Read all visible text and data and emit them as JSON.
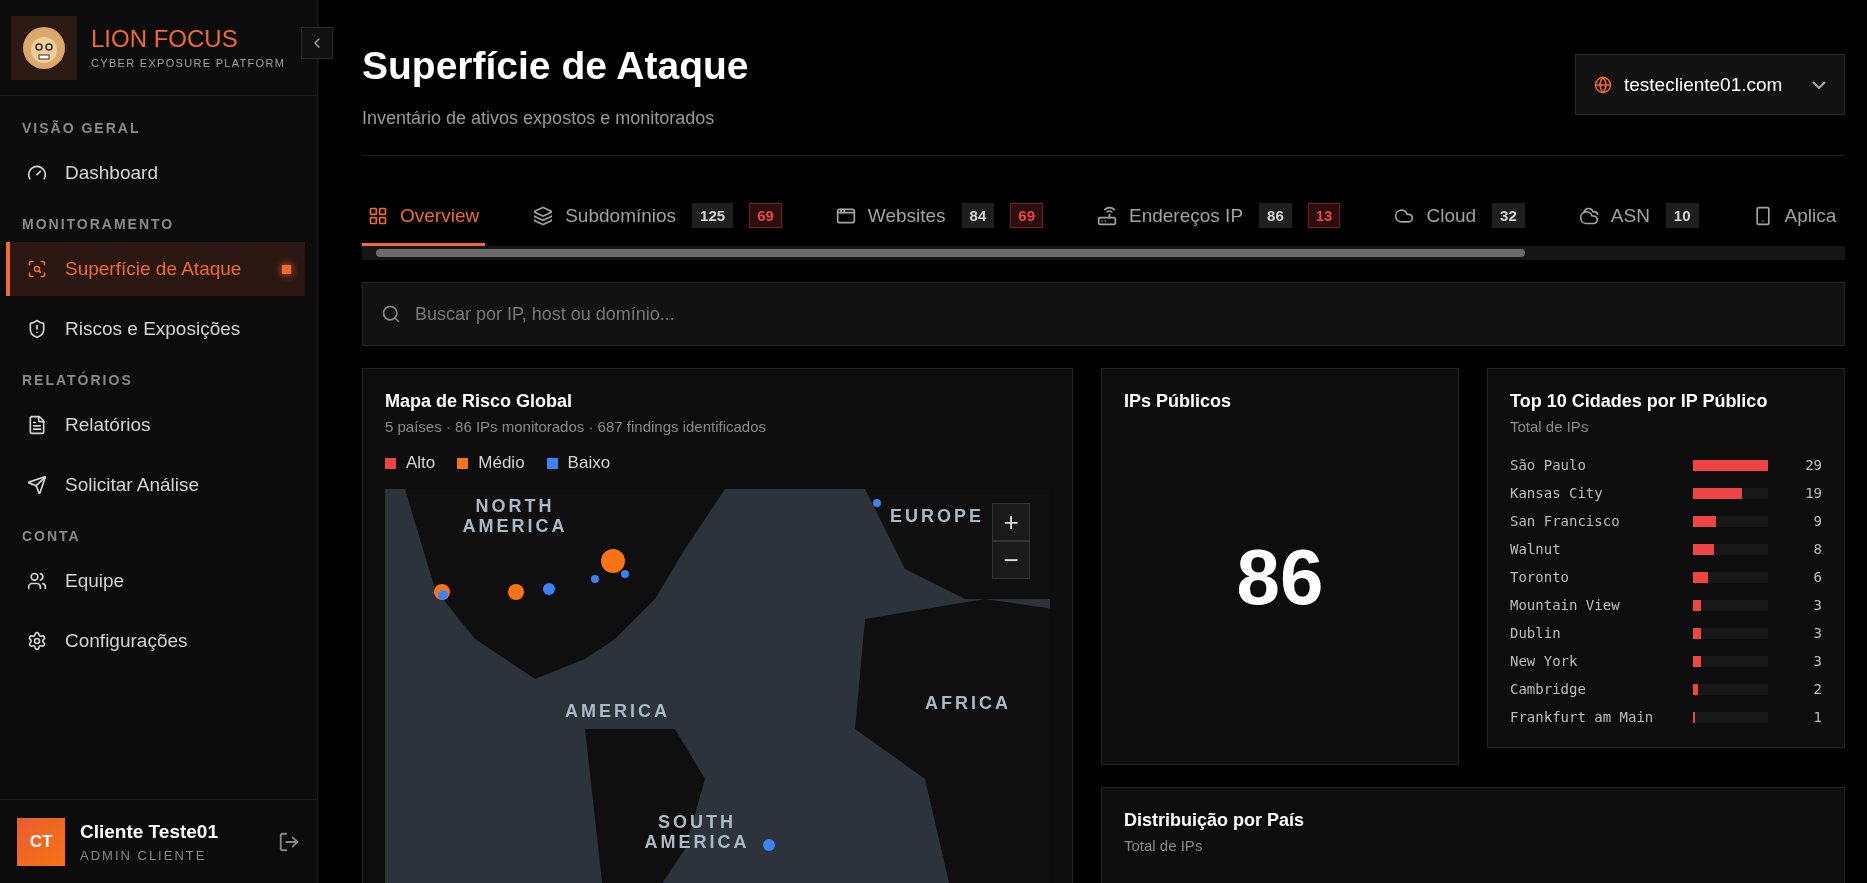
{
  "sidebar": {
    "brand": {
      "name": "LION FOCUS",
      "tagline": "CYBER EXPOSURE PLATFORM"
    },
    "sections": [
      {
        "title": "VISÃO GERAL",
        "items": [
          {
            "label": "Dashboard",
            "selected": false,
            "badge": false
          }
        ]
      },
      {
        "title": "MONITORAMENTO",
        "items": [
          {
            "label": "Superfície de Ataque",
            "selected": true,
            "badge": true
          },
          {
            "label": "Riscos e Exposições",
            "selected": false,
            "badge": false
          }
        ]
      },
      {
        "title": "RELATÓRIOS",
        "items": [
          {
            "label": "Relatórios",
            "selected": false,
            "badge": false
          },
          {
            "label": "Solicitar Análise",
            "selected": false,
            "badge": false
          }
        ]
      },
      {
        "title": "CONTA",
        "items": [
          {
            "label": "Equipe",
            "selected": false,
            "badge": false
          },
          {
            "label": "Configurações",
            "selected": false,
            "badge": false
          }
        ]
      }
    ],
    "user": {
      "initials": "CT",
      "name": "Cliente Teste01",
      "role": "ADMIN CLIENTE"
    }
  },
  "header": {
    "title": "Superfície de Ataque",
    "subtitle": "Inventário de ativos expostos e monitorados",
    "domain": "testecliente01.com"
  },
  "tabs": [
    {
      "label": "Overview",
      "selected": true
    },
    {
      "label": "Subdomínios",
      "selected": false,
      "counts": [
        {
          "text": "125",
          "kind": "total"
        },
        {
          "text": "69",
          "kind": "alert"
        }
      ]
    },
    {
      "label": "Websites",
      "selected": false,
      "counts": [
        {
          "text": "84",
          "kind": "total"
        },
        {
          "text": "69",
          "kind": "alert"
        }
      ]
    },
    {
      "label": "Endereços IP",
      "selected": false,
      "counts": [
        {
          "text": "86",
          "kind": "total"
        },
        {
          "text": "13",
          "kind": "alert"
        }
      ]
    },
    {
      "label": "Cloud",
      "selected": false,
      "counts": [
        {
          "text": "32",
          "kind": "total"
        }
      ]
    },
    {
      "label": "ASN",
      "selected": false,
      "counts": [
        {
          "text": "10",
          "kind": "total"
        }
      ]
    },
    {
      "label": "Aplica",
      "selected": false
    }
  ],
  "search": {
    "placeholder": "Buscar por IP, host ou domínio..."
  },
  "map_card": {
    "title": "Mapa de Risco Global",
    "subtitle": "5 países · 86 IPs monitorados · 687 findings identificados",
    "legend": [
      {
        "label": "Alto",
        "color": "#ef4444"
      },
      {
        "label": "Médio",
        "color": "#f97316"
      },
      {
        "label": "Baixo",
        "color": "#3b82f6"
      }
    ],
    "regions": [
      "NORTH AMERICA",
      "EUROPE",
      "AMERICA",
      "AFRICA",
      "SOUTH AMERICA"
    ],
    "zoom_in": "+",
    "zoom_out": "−"
  },
  "ips_card": {
    "title": "IPs Públicos",
    "value": "86"
  },
  "cities_card": {
    "title": "Top 10 Cidades por IP Público",
    "subtitle": "Total de IPs",
    "rows": [
      {
        "city": "São Paulo",
        "count": "29",
        "level": 1
      },
      {
        "city": "Kansas City",
        "count": "19",
        "level": 0.655
      },
      {
        "city": "San Francisco",
        "count": "9",
        "level": 0.31
      },
      {
        "city": "Walnut",
        "count": "8",
        "level": 0.276
      },
      {
        "city": "Toronto",
        "count": "6",
        "level": 0.207
      },
      {
        "city": "Mountain View",
        "count": "3",
        "level": 0.103
      },
      {
        "city": "Dublin",
        "count": "3",
        "level": 0.103
      },
      {
        "city": "New York",
        "count": "3",
        "level": 0.103
      },
      {
        "city": "Cambridge",
        "count": "2",
        "level": 0.069
      },
      {
        "city": "Frankfurt am Main",
        "count": "1",
        "level": 0.034
      }
    ]
  },
  "country_card": {
    "title": "Distribuição por País",
    "subtitle": "Total de IPs"
  }
}
